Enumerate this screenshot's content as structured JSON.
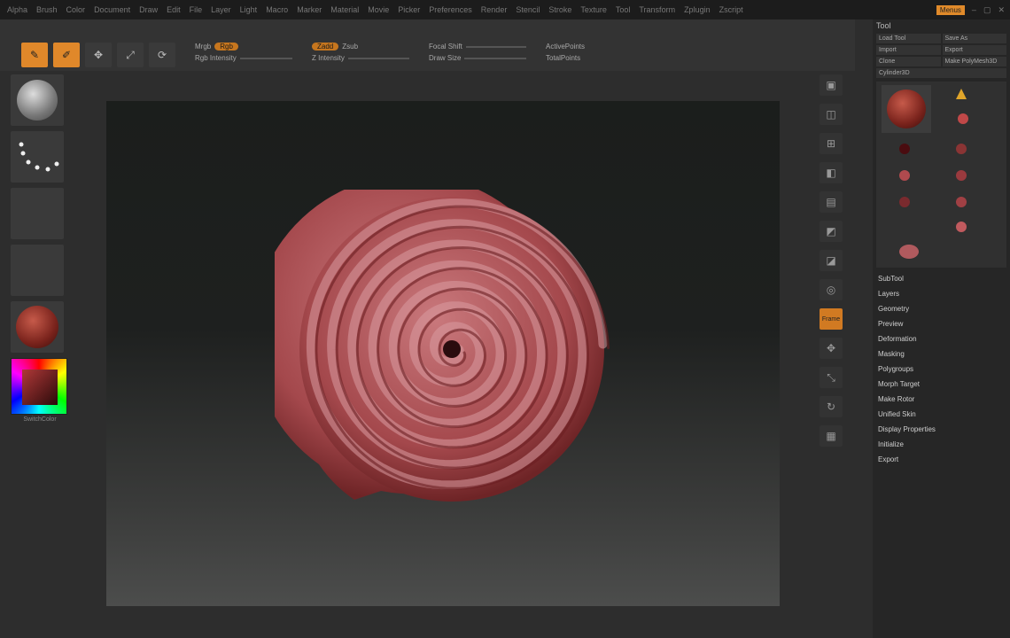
{
  "titlebar": {
    "menus": [
      "Alpha",
      "Brush",
      "Color",
      "Document",
      "Draw",
      "Edit",
      "File",
      "Layer",
      "Light",
      "Macro",
      "Marker",
      "Material",
      "Movie",
      "Picker",
      "Preferences",
      "Render",
      "Stencil",
      "Stroke",
      "Texture",
      "Tool",
      "Transform",
      "Zplugin",
      "Zscript"
    ],
    "badge": "Menus"
  },
  "toolbar": {
    "mrgb_label": "Mrgb",
    "rgb_label": "Rgb",
    "zadd_label": "Zadd",
    "zsub_label": "Zsub",
    "rgb_intensity_label": "Rgb Intensity",
    "z_intensity_label": "Z Intensity",
    "focal_shift_label": "Focal Shift",
    "draw_size_label": "Draw Size",
    "active_points_label": "ActivePoints",
    "total_points_label": "TotalPoints"
  },
  "lefttray": {
    "switch_color": "SwitchColor"
  },
  "rightshelf": {
    "active_label": "Frame"
  },
  "toolpanel": {
    "title": "Tool",
    "buttons": [
      "Load Tool",
      "Save As",
      "Import",
      "Export",
      "Clone",
      "Make PolyMesh3D"
    ],
    "subtool_label": "Cylinder3D",
    "sections": [
      "SubTool",
      "Layers",
      "Geometry",
      "Preview",
      "Deformation",
      "Masking",
      "Polygroups",
      "Morph Target",
      "Make Rotor",
      "Unified Skin",
      "Display Properties",
      "Initialize",
      "Export"
    ]
  },
  "colors": {
    "accent": "#e0882a",
    "spiral": "#b05a5e"
  }
}
